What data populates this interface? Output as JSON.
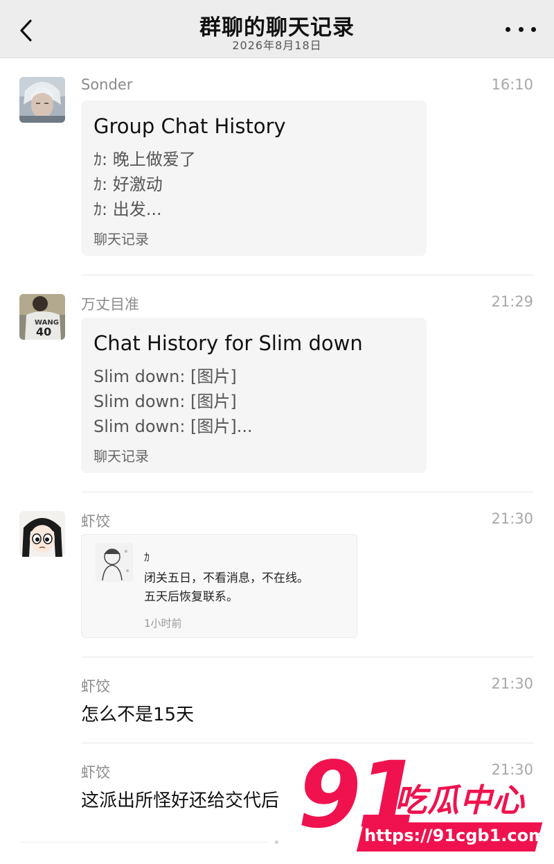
{
  "header": {
    "title": "群聊的聊天记录",
    "subtitle": "2026年8月18日"
  },
  "messages": [
    {
      "sender": "Sonder",
      "time": "16:10",
      "card": {
        "title": "Group Chat History",
        "lines": [
          "ｶ: 晚上做爱了",
          "ｶ: 好激动",
          "ｶ: 出发..."
        ],
        "footer": "聊天记录"
      }
    },
    {
      "sender": "万丈目准",
      "time": "21:29",
      "card": {
        "title": "Chat History for Slim down",
        "lines": [
          "Slim down: [图片]",
          "Slim down: [图片]",
          "Slim down: [图片]..."
        ],
        "footer": "聊天记录"
      }
    },
    {
      "sender": "虾饺",
      "time": "21:30",
      "quote": {
        "name": "ｶ",
        "lines": [
          "闭关五日，不看消息，不在线。",
          "五天后恢复联系。"
        ],
        "time": "1小时前"
      }
    },
    {
      "sender": "虾饺",
      "time": "21:30",
      "text": "怎么不是15天"
    },
    {
      "sender": "虾饺",
      "time": "21:30",
      "text": "这派出所怪好还给交代后"
    }
  ],
  "watermark": {
    "number": "91",
    "text": "吃瓜中心",
    "url": "https://91cgb1.com"
  },
  "icons": {
    "back": "chevron-left-icon",
    "more": "more-dots-icon"
  }
}
